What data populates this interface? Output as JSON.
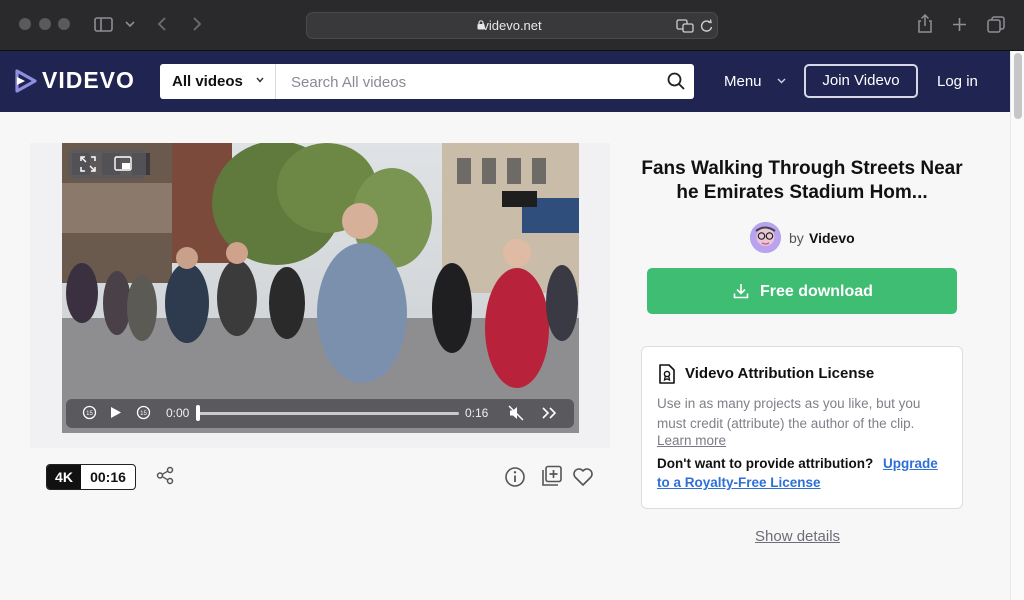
{
  "browser": {
    "url": "videvo.net"
  },
  "site": {
    "logo": "VIDEVO",
    "search": {
      "category": "All videos",
      "placeholder": "Search All videos"
    },
    "nav": {
      "menu": "Menu",
      "join": "Join Videvo",
      "login": "Log in"
    }
  },
  "player": {
    "current_time": "0:00",
    "duration": "0:16",
    "progress": 0.0
  },
  "meta_badge": {
    "resolution": "4K",
    "length": "00:16"
  },
  "clip": {
    "title": "Fans Walking Through Streets Near he Emirates Stadium Hom...",
    "by_label": "by",
    "author": "Videvo",
    "download_label": "Free download"
  },
  "license": {
    "title": "Videvo Attribution License",
    "body": "Use in as many projects as you like, but you must credit (attribute) the author of the clip.",
    "learn_more": "Learn more",
    "question": "Don't want to provide attribution?",
    "upgrade_line1": "Upgrade",
    "upgrade_line2": "to a Royalty-Free License"
  },
  "show_details": "Show details",
  "colors": {
    "header_bg": "#1f2451",
    "download_green": "#3ebd73",
    "link_blue": "#2f6fd6"
  }
}
